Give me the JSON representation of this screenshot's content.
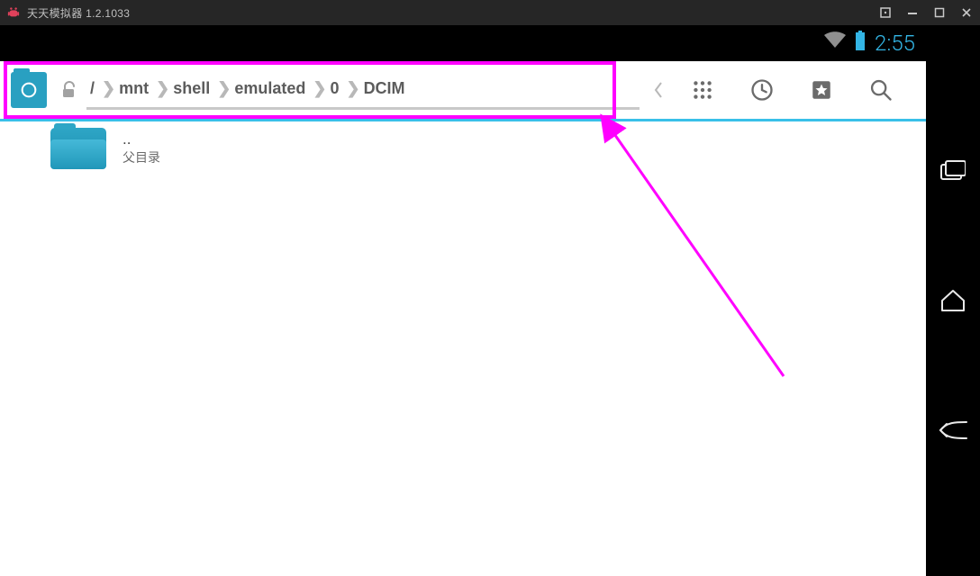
{
  "window": {
    "title": "天天模拟器 1.2.1033"
  },
  "statusbar": {
    "clock": "2:55"
  },
  "toolbar": {
    "breadcrumbs": [
      "/",
      "mnt",
      "shell",
      "emulated",
      "0",
      "DCIM"
    ]
  },
  "files": {
    "parent": {
      "name": "..",
      "sub": "父目录"
    }
  },
  "colors": {
    "accent": "#33B5E5",
    "folder": "#29A0C1",
    "annotation": "#FF00FF"
  }
}
